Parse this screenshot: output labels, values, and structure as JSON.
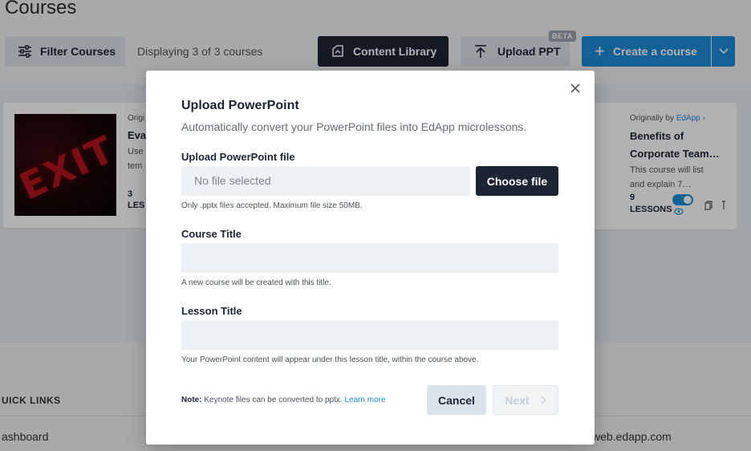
{
  "page": {
    "title": "Courses"
  },
  "toolbar": {
    "filter_label": "Filter Courses",
    "displaying": "Displaying 3 of 3 courses",
    "library_label": "Content Library",
    "upload_label": "Upload PPT",
    "beta_badge": "BETA",
    "create_label": "Create a course"
  },
  "courses": {
    "left": {
      "origin_prefix": "Origi",
      "title_fragment": "Eva",
      "desc_line1": "Use",
      "desc_line2": "tem",
      "lesson_count": "3",
      "lessons_fragment": "LES"
    },
    "right": {
      "origin_prefix": "Originally by",
      "origin_link": "EdApp",
      "title_line1": "Benefits of",
      "title_line2": "Corporate Team…",
      "desc_line1": "This course will list",
      "desc_line2": "and explain 7…",
      "lesson_count": "9",
      "lessons_label": "LESSONS"
    },
    "thumb_text": "EXIT"
  },
  "quick_links": {
    "title": "UICK LINKS",
    "dashboard": "ashboard",
    "web": "web.edapp.com"
  },
  "modal": {
    "title": "Upload PowerPoint",
    "subtitle": "Automatically convert your PowerPoint files into EdApp microlessons.",
    "file_label": "Upload PowerPoint file",
    "file_placeholder": "No file selected",
    "choose_label": "Choose file",
    "file_help": "Only .pptx files accepted. Maximum file size 50MB.",
    "course_label": "Course Title",
    "course_value": "",
    "course_help": "A new course will be created with this title.",
    "lesson_label": "Lesson Title",
    "lesson_value": "",
    "lesson_help": "Your PowerPoint content will appear under this lesson title, within the course above.",
    "note_bold": "Note:",
    "note_text": " Keynote files can be converted to pptx. ",
    "note_link": "Learn more",
    "cancel_label": "Cancel",
    "next_label": "Next"
  },
  "colors": {
    "primary_dark": "#1d2433",
    "accent_blue": "#1e8bd6",
    "muted_button": "#dde3ea",
    "input_bg": "#eef1f4"
  }
}
